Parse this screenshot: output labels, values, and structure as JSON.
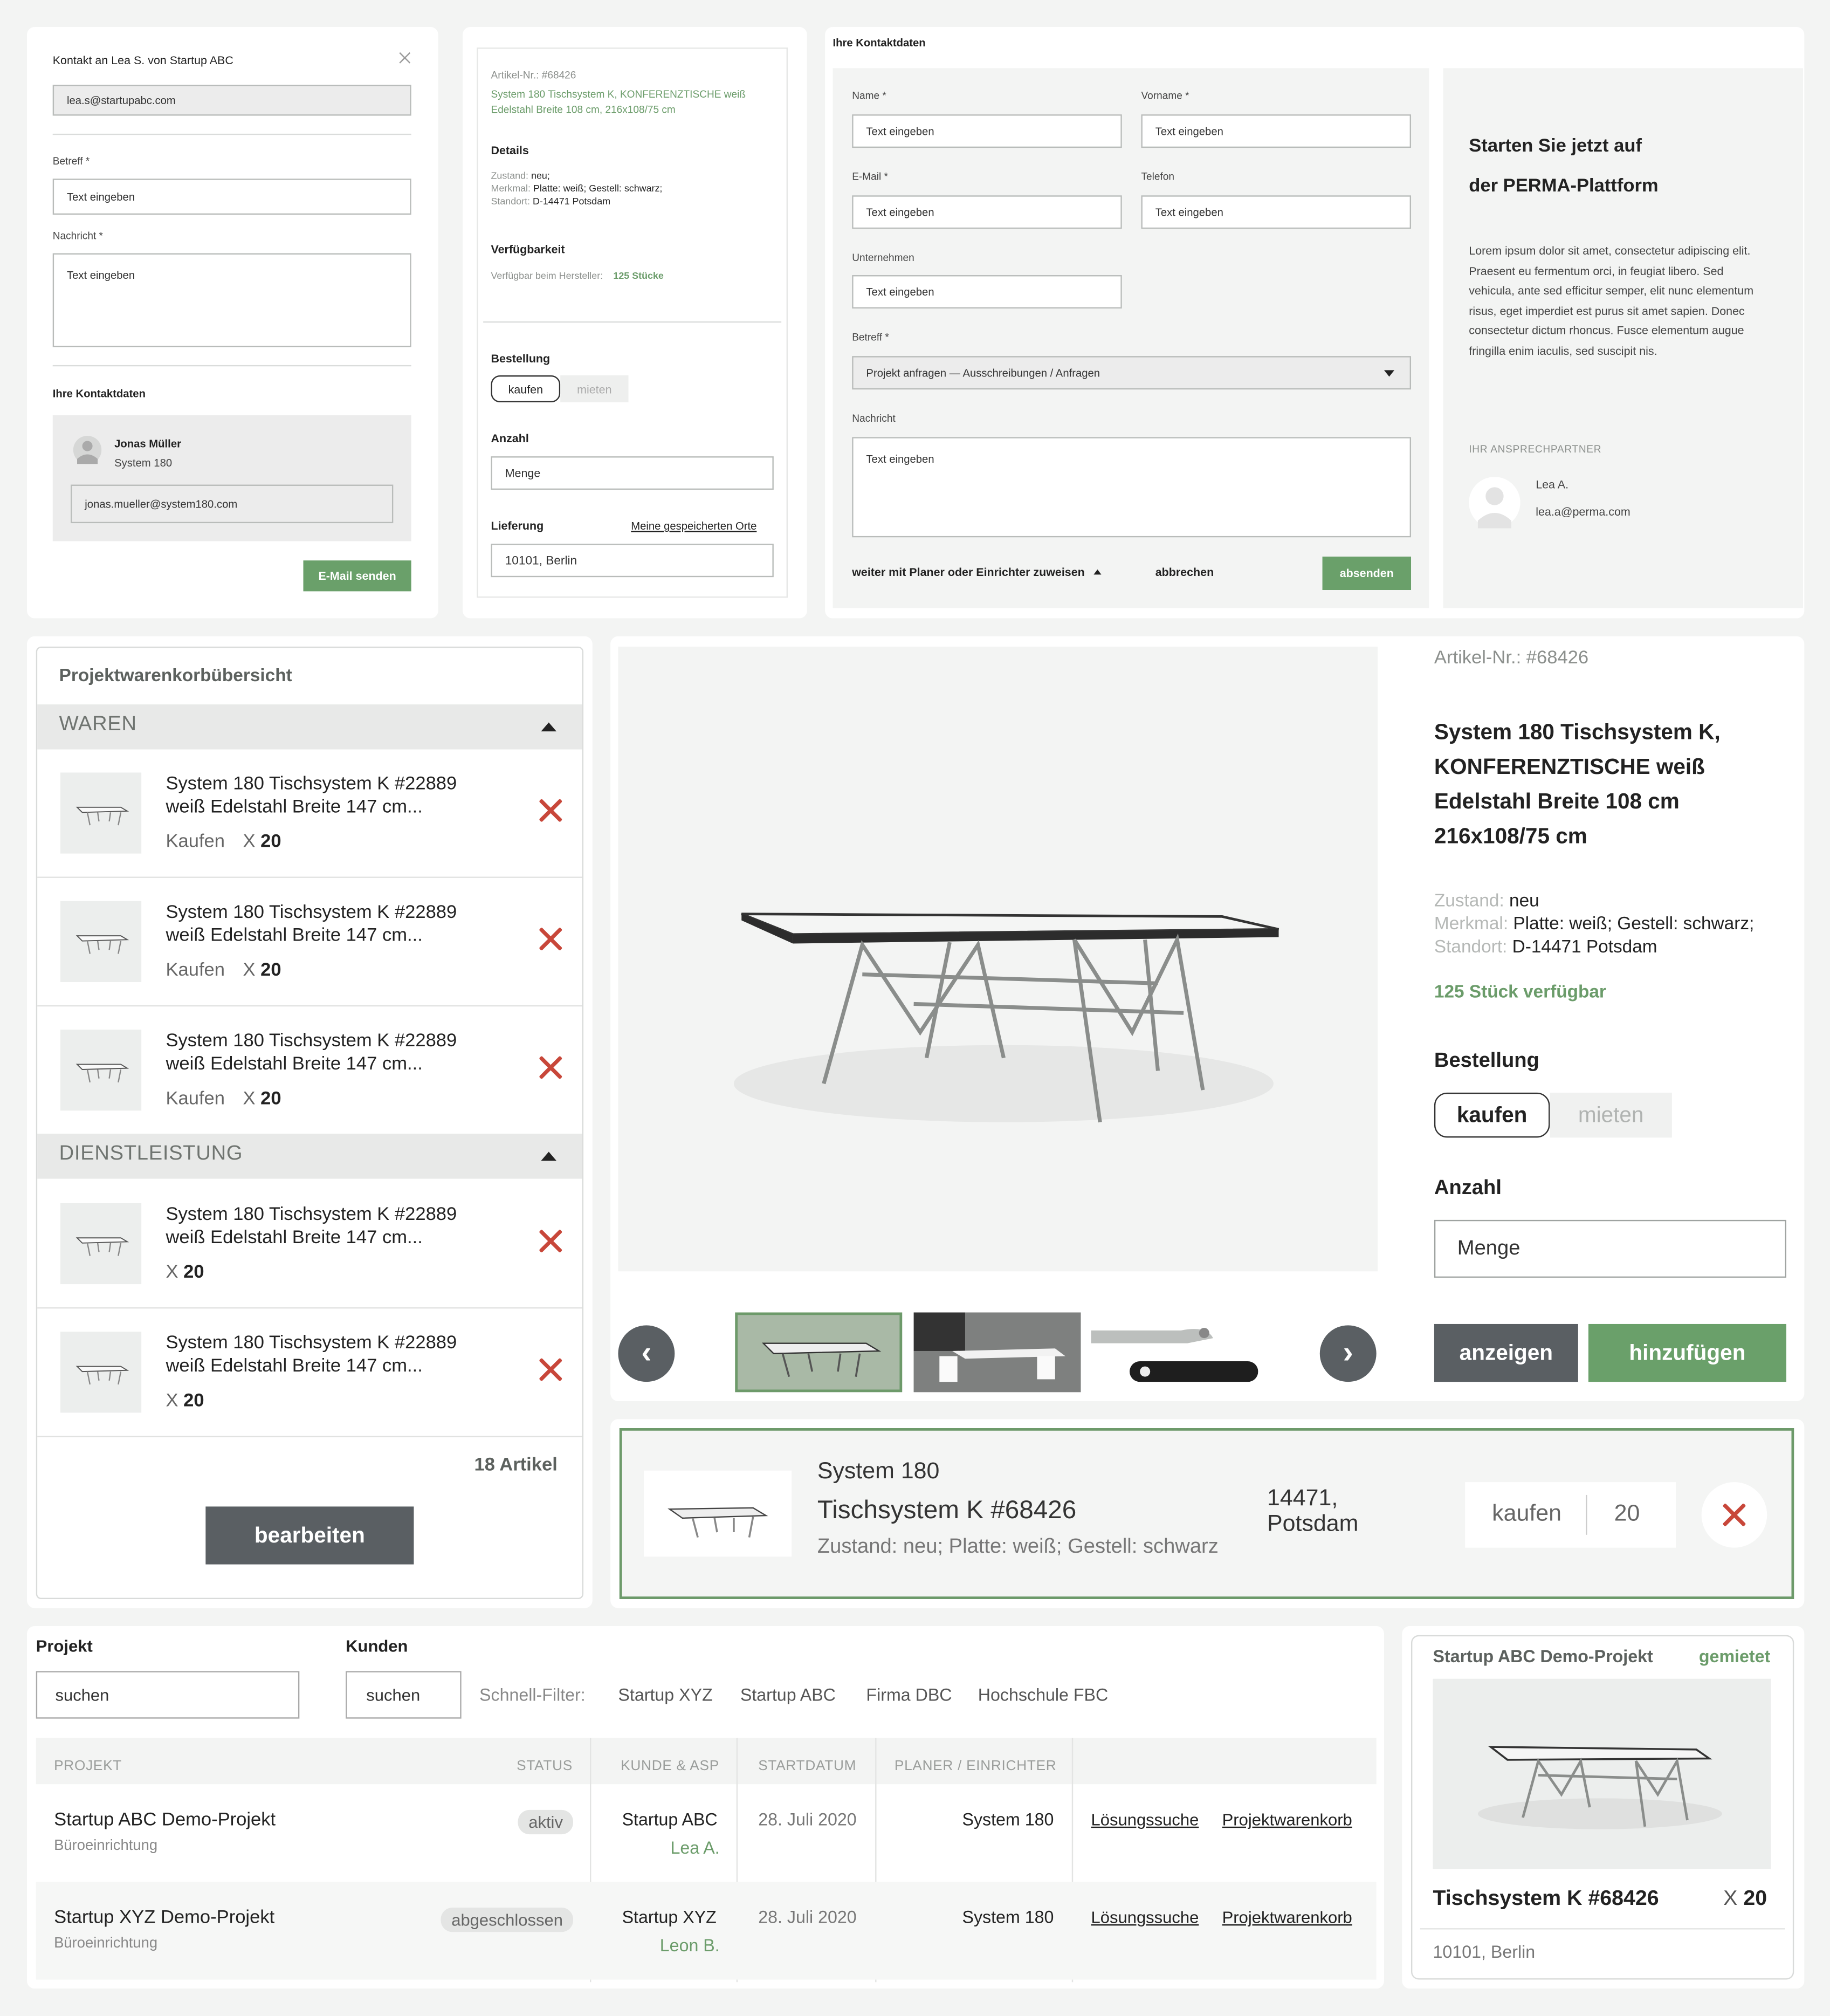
{
  "contact_form": {
    "title": "Kontakt an Lea S. von Startup ABC",
    "to_email": "lea.s@startupabc.com",
    "subject_label": "Betreff *",
    "subject_placeholder": "Text eingeben",
    "message_label": "Nachricht *",
    "message_placeholder": "Text eingeben",
    "contact_section_title": "Ihre Kontaktdaten",
    "contact_name": "Jonas Müller",
    "contact_company": "System 180",
    "contact_email": "jonas.mueller@system180.com",
    "send_button": "E-Mail senden"
  },
  "product_mini": {
    "article_no": "Artikel-Nr.: #68426",
    "title_line1": "System 180 Tischsystem K, KONFERENZTISCHE weiß",
    "title_line2": "Edelstahl Breite 108 cm, 216x108/75 cm",
    "details_heading": "Details",
    "zustand_label": "Zustand:",
    "zustand_value": "neu;",
    "merkmal_label": "Merkmal:",
    "merkmal_value": "Platte: weiß; Gestell: schwarz;",
    "standort_label": "Standort:",
    "standort_value": "D-14471 Potsdam",
    "availability_heading": "Verfügbarkeit",
    "availability_label": "Verfügbar beim Hersteller:",
    "availability_value": "125 Stücke",
    "order_heading": "Bestellung",
    "buy": "kaufen",
    "rent": "mieten",
    "quantity_heading": "Anzahl",
    "quantity_placeholder": "Menge",
    "delivery_heading": "Lieferung",
    "saved_places_link": "Meine gespeicherten Orte",
    "delivery_value": "10101, Berlin"
  },
  "contact_large": {
    "title": "Ihre Kontaktdaten",
    "name_label": "Name *",
    "firstname_label": "Vorname *",
    "email_label": "E-Mail *",
    "phone_label": "Telefon",
    "company_label": "Unternehmen",
    "subject_label": "Betreff *",
    "message_label": "Nachricht",
    "placeholder": "Text eingeben",
    "subject_value": "Projekt anfragen — Ausschreibungen / Anfragen",
    "assign_link": "weiter mit Planer oder Einrichter zuweisen",
    "cancel": "abbrechen",
    "submit": "absenden",
    "promo_heading_1": "Starten Sie jetzt auf",
    "promo_heading_2": "der PERMA-Plattform",
    "promo_text": "Lorem ipsum dolor sit amet, consectetur adipiscing elit. Praesent eu fermentum orci, in feugiat libero. Sed vehicula, ante sed efficitur semper, elit nunc elementum risus, eget imperdiet est purus sit amet sapien. Donec consectetur dictum rhoncus. Fusce elementum augue fringilla enim iaculis, sed suscipit nis.",
    "partner_heading": "IHR ANSPRECHPARTNER",
    "partner_name": "Lea A.",
    "partner_email": "lea.a@perma.com"
  },
  "cart": {
    "title": "Projektwarenkorbübersicht",
    "section_goods": "WAREN",
    "section_service": "DIENSTLEISTUNG",
    "item_line1": "System 180 Tischsystem K #22889",
    "item_line2": "weiß Edelstahl Breite 147 cm...",
    "buy_label": "Kaufen",
    "qty_prefix": "X",
    "qty": "20",
    "total": "18 Artikel",
    "edit_button": "bearbeiten"
  },
  "product_detail": {
    "article_no": "Artikel-Nr.: #68426",
    "title": [
      "System 180 Tischsystem K,",
      "KONFERENZTISCHE weiß",
      "Edelstahl Breite 108 cm",
      "216x108/75 cm"
    ],
    "zustand_label": "Zustand:",
    "zustand_value": "neu",
    "merkmal_label": "Merkmal:",
    "merkmal_value": "Platte: weiß; Gestell: schwarz;",
    "standort_label": "Standort:",
    "standort_value": "D-14471 Potsdam",
    "availability": "125 Stück verfügbar",
    "order_heading": "Bestellung",
    "buy": "kaufen",
    "rent": "mieten",
    "quantity_heading": "Anzahl",
    "quantity_placeholder": "Menge",
    "show_button": "anzeigen",
    "add_button": "hinzufügen",
    "prev": "‹",
    "next": "›"
  },
  "cart_line": {
    "brand": "System 180",
    "product": "Tischsystem K #68426",
    "details": "Zustand: neu; Platte: weiß; Gestell: schwarz",
    "location_1": "14471,",
    "location_2": "Potsdam",
    "mode": "kaufen",
    "qty": "20"
  },
  "projects": {
    "project_label": "Projekt",
    "customer_label": "Kunden",
    "search_placeholder": "suchen",
    "quick_filter_label": "Schnell-Filter:",
    "filters": [
      "Startup XYZ",
      "Startup ABC",
      "Firma DBC",
      "Hochschule FBC"
    ],
    "headers": {
      "project": "PROJEKT",
      "status": "STATUS",
      "customer": "KUNDE & ASP",
      "start": "STARTDATUM",
      "planner": "PLANER / EINRICHTER"
    },
    "rows": [
      {
        "name": "Startup ABC Demo-Projekt",
        "type": "Büroeinrichtung",
        "status": "aktiv",
        "customer": "Startup ABC",
        "contact": "Lea A.",
        "start": "28. Juli 2020",
        "planner": "System 180",
        "link1": "Lösungssuche",
        "link2": "Projektwarenkorb"
      },
      {
        "name": "Startup XYZ Demo-Projekt",
        "type": "Büroeinrichtung",
        "status": "abgeschlossen",
        "customer": "Startup XYZ",
        "contact": "Leon B.",
        "start": "28. Juli 2020",
        "planner": "System 180",
        "link1": "Lösungssuche",
        "link2": "Projektwarenkorb"
      }
    ]
  },
  "project_card": {
    "project": "Startup ABC Demo-Projekt",
    "badge": "gemietet",
    "product": "Tischsystem K #68426",
    "qty_prefix": "X",
    "qty": "20",
    "location": "10101, Berlin"
  }
}
